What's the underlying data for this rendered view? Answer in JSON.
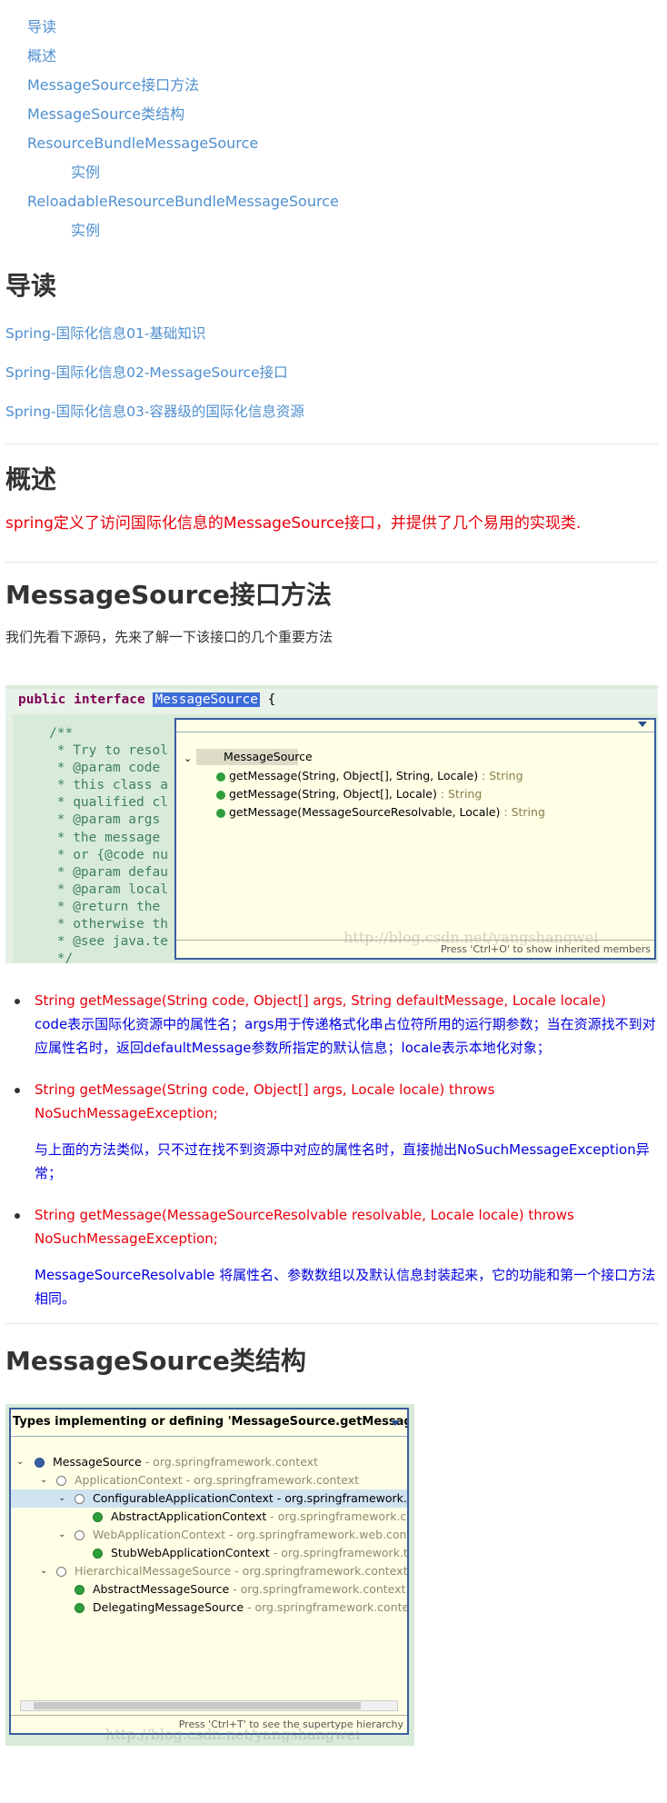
{
  "toc": {
    "items": [
      {
        "label": "导读",
        "indent": false
      },
      {
        "label": "概述",
        "indent": false
      },
      {
        "label": "MessageSource接口方法",
        "indent": false
      },
      {
        "label": "MessageSource类结构",
        "indent": false
      },
      {
        "label": "ResourceBundleMessageSource",
        "indent": false
      },
      {
        "label": "实例",
        "indent": true
      },
      {
        "label": "ReloadableResourceBundleMessageSource",
        "indent": false
      },
      {
        "label": "实例",
        "indent": true
      }
    ]
  },
  "daodu": {
    "heading": "导读",
    "links": [
      "Spring-国际化信息01-基础知识",
      "Spring-国际化信息02-MessageSource接口",
      "Spring-国际化信息03-容器级的国际化信息资源"
    ]
  },
  "gaishu": {
    "heading": "概述",
    "text": "spring定义了访问国际化信息的MessageSource接口，并提供了几个易用的实现类."
  },
  "methods_section": {
    "heading": "MessageSource接口方法",
    "intro": "我们先看下源码，先来了解一下该接口的几个重要方法"
  },
  "code_screenshot": {
    "kw_public": "public",
    "kw_interface": "interface",
    "type_name": "MessageSource",
    "brace": "{",
    "comment_lines": "/**\n * Try to resol\n * @param code\n * this class a\n * qualified cl\n * @param args\n * the message\n * or {@code nu\n * @param defau\n * @param local\n * @return the\n * otherwise th\n * @see java.te\n */",
    "popup": {
      "root": "MessageSource",
      "methods": [
        {
          "sig": "getMessage(String, Object[], String, Locale)",
          "ret": " : String"
        },
        {
          "sig": "getMessage(String, Object[], Locale)",
          "ret": " : String"
        },
        {
          "sig": "getMessage(MessageSourceResolvable, Locale)",
          "ret": " : String"
        }
      ],
      "footer": "Press 'Ctrl+O' to show inherited members"
    },
    "watermark": "http://blog.csdn.net/yangshangwei"
  },
  "method_list": [
    {
      "sig": "String getMessage(String code, Object[] args, String defaultMessage, Locale locale)",
      "desc": "code表示国际化资源中的属性名；args用于传递格式化串占位符所用的运行期参数；当在资源找不到对应属性名时，返回defaultMessage参数所指定的默认信息；locale表示本地化对象；"
    },
    {
      "sig": "String getMessage(String code, Object[] args, Locale locale) throws NoSuchMessageException;",
      "desc": "与上面的方法类似，只不过在找不到资源中对应的属性名时，直接抛出NoSuchMessageException异常；"
    },
    {
      "sig": "String getMessage(MessageSourceResolvable resolvable, Locale locale) throws NoSuchMessageException;",
      "desc": "MessageSourceResolvable 将属性名、参数数组以及默认信息封装起来，它的功能和第一个接口方法相同。"
    }
  ],
  "struct_section": {
    "heading": "MessageSource类结构"
  },
  "hierarchy_screenshot": {
    "title": "Types implementing or defining 'MessageSource.getMessage(Strin",
    "rows": [
      {
        "name": "MessageSource",
        "pkg": " - org.springframework.context"
      },
      {
        "name": "ApplicationContext",
        "pkg": " - org.springframework.context"
      },
      {
        "name": "ConfigurableApplicationContext",
        "pkg": " - org.springframework.c"
      },
      {
        "name": "AbstractApplicationContext",
        "pkg": " - org.springframework.c"
      },
      {
        "name": "WebApplicationContext",
        "pkg": " - org.springframework.web.conte"
      },
      {
        "name": "StubWebApplicationContext",
        "pkg": " - org.springframework.t"
      },
      {
        "name": "HierarchicalMessageSource",
        "pkg": " - org.springframework.context"
      },
      {
        "name": "AbstractMessageSource",
        "pkg": " - org.springframework.context.s"
      },
      {
        "name": "DelegatingMessageSource",
        "pkg": " - org.springframework.contex"
      }
    ],
    "hint": "Press 'Ctrl+T' to see the supertype hierarchy",
    "watermark": "http://blog.csdn.net/yangshangwei"
  },
  "colors": {
    "link": "#4f8fcf",
    "red_text": "#e8000a",
    "blue_text": "#0000e0",
    "keyword": "#7f0055",
    "comment": "#3f7f5f"
  }
}
